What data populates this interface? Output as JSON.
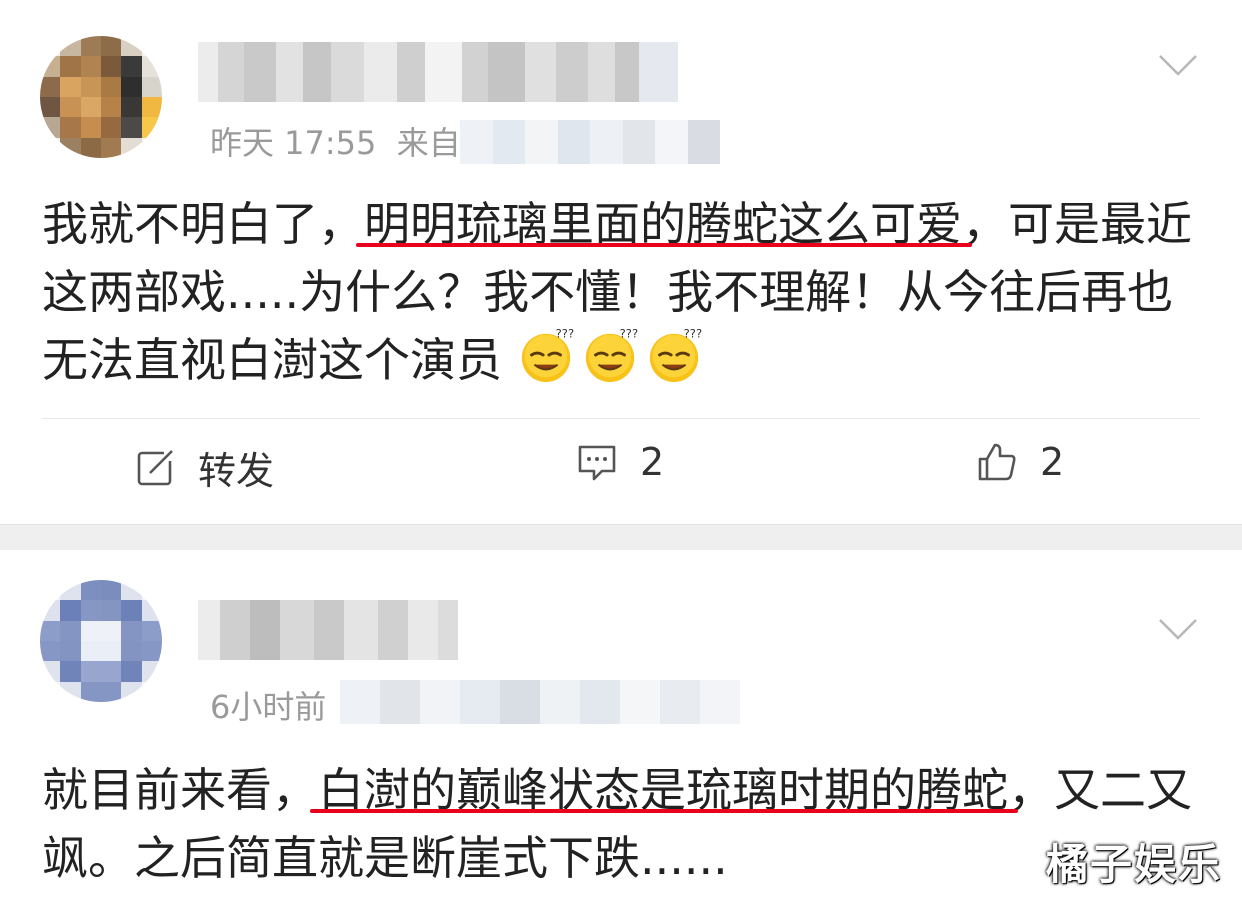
{
  "posts": [
    {
      "timestamp": "昨天 17:55",
      "source_prefix": "来自",
      "text_before": "我就不明白了，",
      "text_highlight": "明明琉璃里面的腾蛇这么可爱",
      "text_after": "，可是最近这两部戏.....为什么？我不懂！我不理解！从今往后再也无法直视白澍这个演员",
      "emojis": [
        "dizzy-face-emoji",
        "dizzy-face-emoji",
        "dizzy-face-emoji"
      ],
      "actions": {
        "repost_label": "转发",
        "comment_count": "2",
        "like_count": "2"
      }
    },
    {
      "timestamp": "6小时前",
      "text_before": "就目前来看，",
      "text_highlight": "白澍的巅峰状态是琉璃时期的腾蛇",
      "text_after": "，又二又飒。之后简直就是断崖式下跌......"
    }
  ],
  "watermark": "橘子娱乐",
  "colors": {
    "highlight_underline": "#e8001c",
    "meta_text": "#9a9a9a",
    "separator": "#efefef"
  }
}
